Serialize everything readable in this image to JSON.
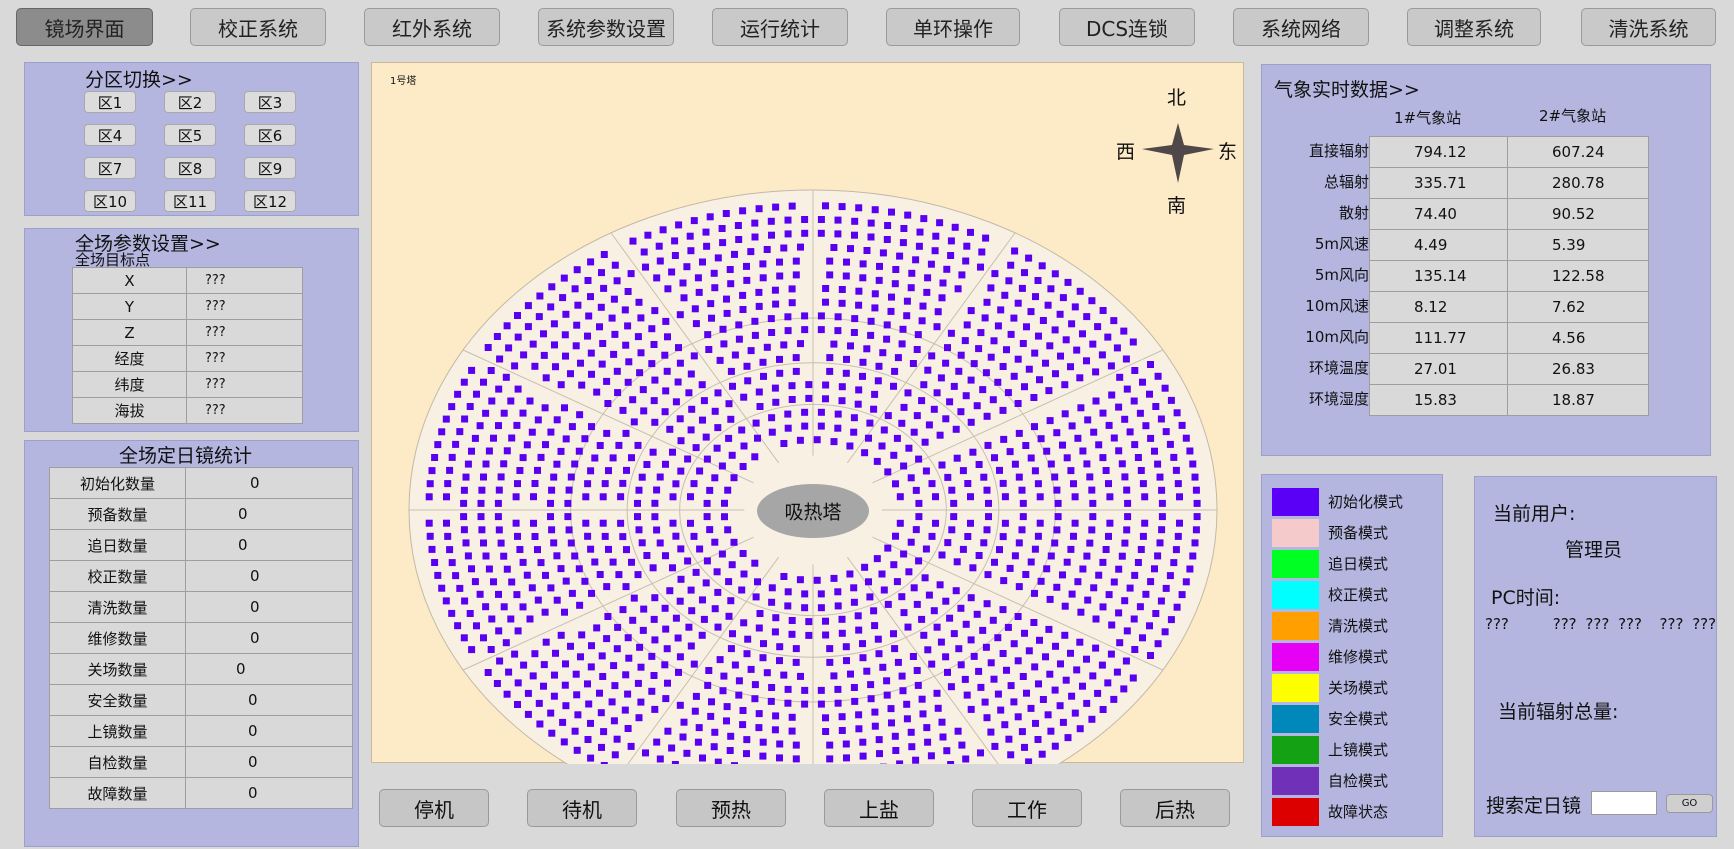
{
  "nav": [
    {
      "label": "镜场界面",
      "active": true
    },
    {
      "label": "校正系统"
    },
    {
      "label": "红外系统"
    },
    {
      "label": "系统参数设置"
    },
    {
      "label": "运行统计"
    },
    {
      "label": "单环操作"
    },
    {
      "label": "DCS连锁"
    },
    {
      "label": "系统网络"
    },
    {
      "label": "调整系统"
    },
    {
      "label": "清洗系统"
    }
  ],
  "zones": {
    "title": "分区切换>>",
    "items": [
      "区1",
      "区2",
      "区3",
      "区4",
      "区5",
      "区6",
      "区7",
      "区8",
      "区9",
      "区10",
      "区11",
      "区12"
    ]
  },
  "params": {
    "title": "全场参数设置>>",
    "subtitle": "全场目标点",
    "rows": [
      {
        "label": "X",
        "value": "???"
      },
      {
        "label": "Y",
        "value": "???"
      },
      {
        "label": "Z",
        "value": "???"
      },
      {
        "label": "经度",
        "value": "???"
      },
      {
        "label": "纬度",
        "value": "???"
      },
      {
        "label": "海拔",
        "value": "???"
      }
    ]
  },
  "stats": {
    "title": "全场定日镜统计",
    "rows": [
      {
        "label": "初始化数量",
        "value": "0"
      },
      {
        "label": "预备数量",
        "value": "0"
      },
      {
        "label": "追日数量",
        "value": "0"
      },
      {
        "label": "校正数量",
        "value": "0"
      },
      {
        "label": "清洗数量",
        "value": "0"
      },
      {
        "label": "维修数量",
        "value": "0"
      },
      {
        "label": "关场数量",
        "value": "0"
      },
      {
        "label": "安全数量",
        "value": "0"
      },
      {
        "label": "上镜数量",
        "value": "0"
      },
      {
        "label": "自检数量",
        "value": "0"
      },
      {
        "label": "故障数量",
        "value": "0"
      }
    ]
  },
  "field": {
    "tower_label": "1号塔",
    "receiver": "吸热塔",
    "compass": {
      "n": "北",
      "s": "南",
      "e": "东",
      "w": "西"
    },
    "mirror_color": "#5a00f0",
    "bg_color": "#fdebc7",
    "ellipse_color": "#f8f1e3"
  },
  "weather": {
    "title": "气象实时数据>>",
    "stations": [
      "1#气象站",
      "2#气象站"
    ],
    "rows": [
      {
        "label": "直接辐射",
        "v1": "794.12",
        "v2": "607.24"
      },
      {
        "label": "总辐射",
        "v1": "335.71",
        "v2": "280.78"
      },
      {
        "label": "散射",
        "v1": "74.40",
        "v2": "90.52"
      },
      {
        "label": "5m风速",
        "v1": "4.49",
        "v2": "5.39"
      },
      {
        "label": "5m风向",
        "v1": "135.14",
        "v2": "122.58"
      },
      {
        "label": "10m风速",
        "v1": "8.12",
        "v2": "7.62"
      },
      {
        "label": "10m风向",
        "v1": "111.77",
        "v2": "4.56"
      },
      {
        "label": "环境温度",
        "v1": "27.01",
        "v2": "26.83"
      },
      {
        "label": "环境湿度",
        "v1": "15.83",
        "v2": "18.87"
      }
    ]
  },
  "legend": [
    {
      "label": "初始化模式",
      "color": "#5a00f7"
    },
    {
      "label": "预备模式",
      "color": "#f4caca"
    },
    {
      "label": "追日模式",
      "color": "#00ff22"
    },
    {
      "label": "校正模式",
      "color": "#00ffff"
    },
    {
      "label": "清洗模式",
      "color": "#ff9f00"
    },
    {
      "label": "维修模式",
      "color": "#e600f5"
    },
    {
      "label": "关场模式",
      "color": "#ffff00"
    },
    {
      "label": "安全模式",
      "color": "#0088bb"
    },
    {
      "label": "上镜模式",
      "color": "#14a214"
    },
    {
      "label": "自检模式",
      "color": "#7030b8"
    },
    {
      "label": "故障状态",
      "color": "#dd0000"
    }
  ],
  "user": {
    "user_label": "当前用户:",
    "user_name": "管理员",
    "pc_time_label": "PC时间:",
    "time_parts": [
      "???",
      "???",
      "???",
      "???",
      "???",
      "???"
    ],
    "radiation_label": "当前辐射总量:",
    "search_label": "搜索定日镜",
    "search_value": "",
    "go_label": "GO"
  },
  "controls": [
    "停机",
    "待机",
    "预热",
    "上盐",
    "工作",
    "后热"
  ]
}
